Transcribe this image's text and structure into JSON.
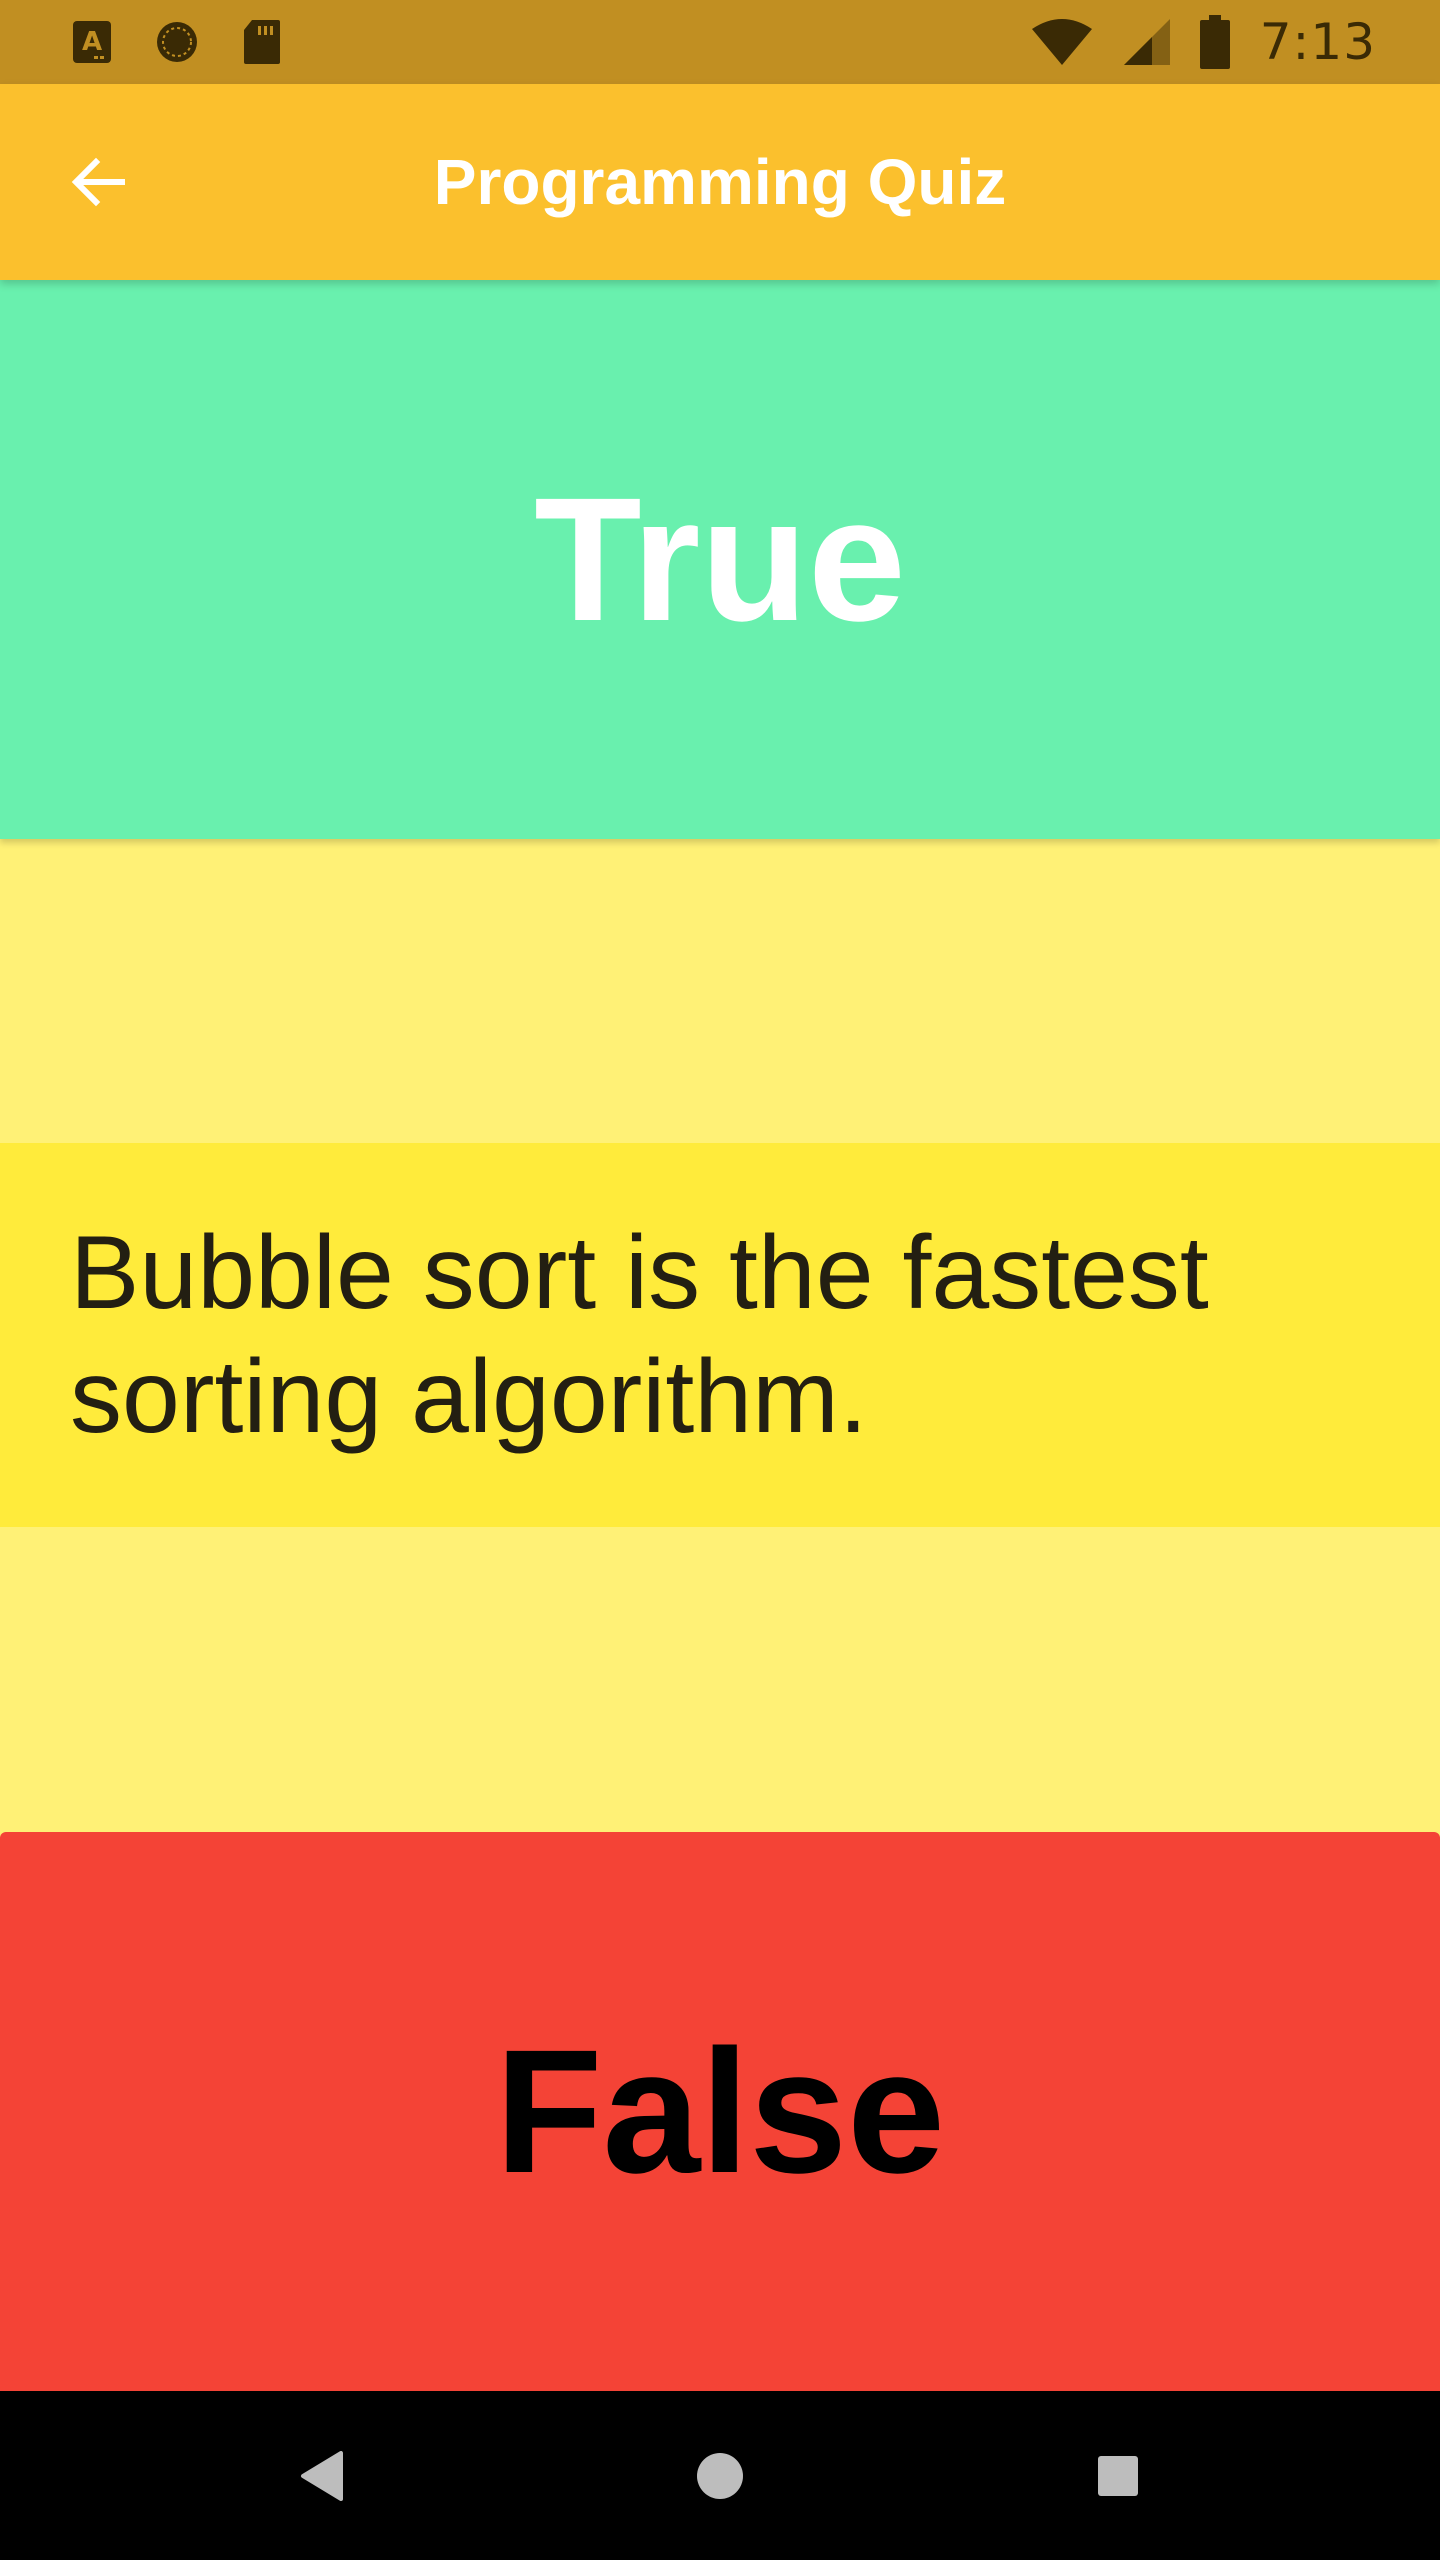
{
  "status_bar": {
    "time": "7:13",
    "left_icons": [
      "a-keyboard-icon",
      "sync-circle-icon",
      "sd-card-icon"
    ],
    "right_icons": [
      "wifi-icon",
      "cell-signal-icon",
      "battery-icon"
    ]
  },
  "app_bar": {
    "title": "Programming Quiz",
    "back_icon": "arrow-back-icon"
  },
  "answers": {
    "true_label": "True",
    "false_label": "False"
  },
  "question": {
    "text": "Bubble sort is the fastest sorting algorithm."
  },
  "nav_bar": {
    "icons": [
      "nav-back-icon",
      "nav-home-icon",
      "nav-recents-icon"
    ]
  },
  "colors": {
    "status_bar": "#C18F22",
    "app_bar": "#FBC02D",
    "background": "#FFF176",
    "question_panel": "#FFEB3B",
    "true_button": "#69F0AE",
    "false_button": "#F44336",
    "nav_bar": "#000000"
  }
}
